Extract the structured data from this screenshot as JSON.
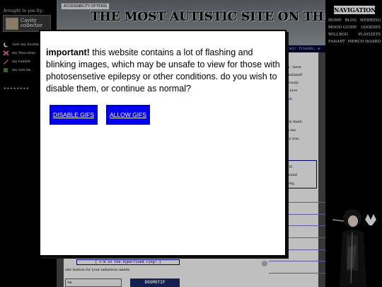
{
  "left": {
    "brought": "brought to you by:",
    "collector_name": "Cavity collector",
    "links": [
      {
        "icon": "moon-icon",
        "label": "visit my duolingo"
      },
      {
        "icon": "x-icon",
        "label": "my Neocities"
      },
      {
        "icon": "pencil-icon",
        "label": "my tumblr"
      },
      {
        "icon": "cube-icon",
        "label": "my last.fm"
      }
    ],
    "stars": "★★★★★★★★"
  },
  "center": {
    "accessibility_button": "ACCESSIBILITY OPTIONS",
    "site_title": "THE MOST AUTISTIC SITE ON THE WEB",
    "friends_text": "their friends, w",
    "right_texts": [
      "ness - here",
      "get related!",
      "tml/css/js",
      "that love",
      "y web",
      "as my main",
      "with me",
      "nests you.",
      "MAIN",
      "personal",
      "ies.org,",
      "h."
    ],
    "hyperfixed": "[ i'm in the hyperfixed ring! ]",
    "site_button_text": "site button for your nefarious needs",
    "code_value": "<a",
    "dogmotif": "DOGMOTIF"
  },
  "nav": {
    "title": "NAVIGATION",
    "items": [
      "HOME",
      "BLOG",
      "WEBRING",
      "MOOD GUIDE",
      "GOODIES",
      "WILLBOG",
      "PLAYLISTS",
      "FANART",
      "MERCH HOARD"
    ]
  },
  "modal": {
    "important": "important!",
    "message": " this website contains a lot of flashing and blinking images, which may be unsafe to view for those with photosensetive epilepsy or other conditions. do you wish to disable them, or continue as normal?",
    "disable_label": "DISABLE GIFS",
    "allow_label": "ALLOW GIFS"
  },
  "colors": {
    "button_blue": "#0000ee",
    "page_bg": "#ffffff"
  }
}
